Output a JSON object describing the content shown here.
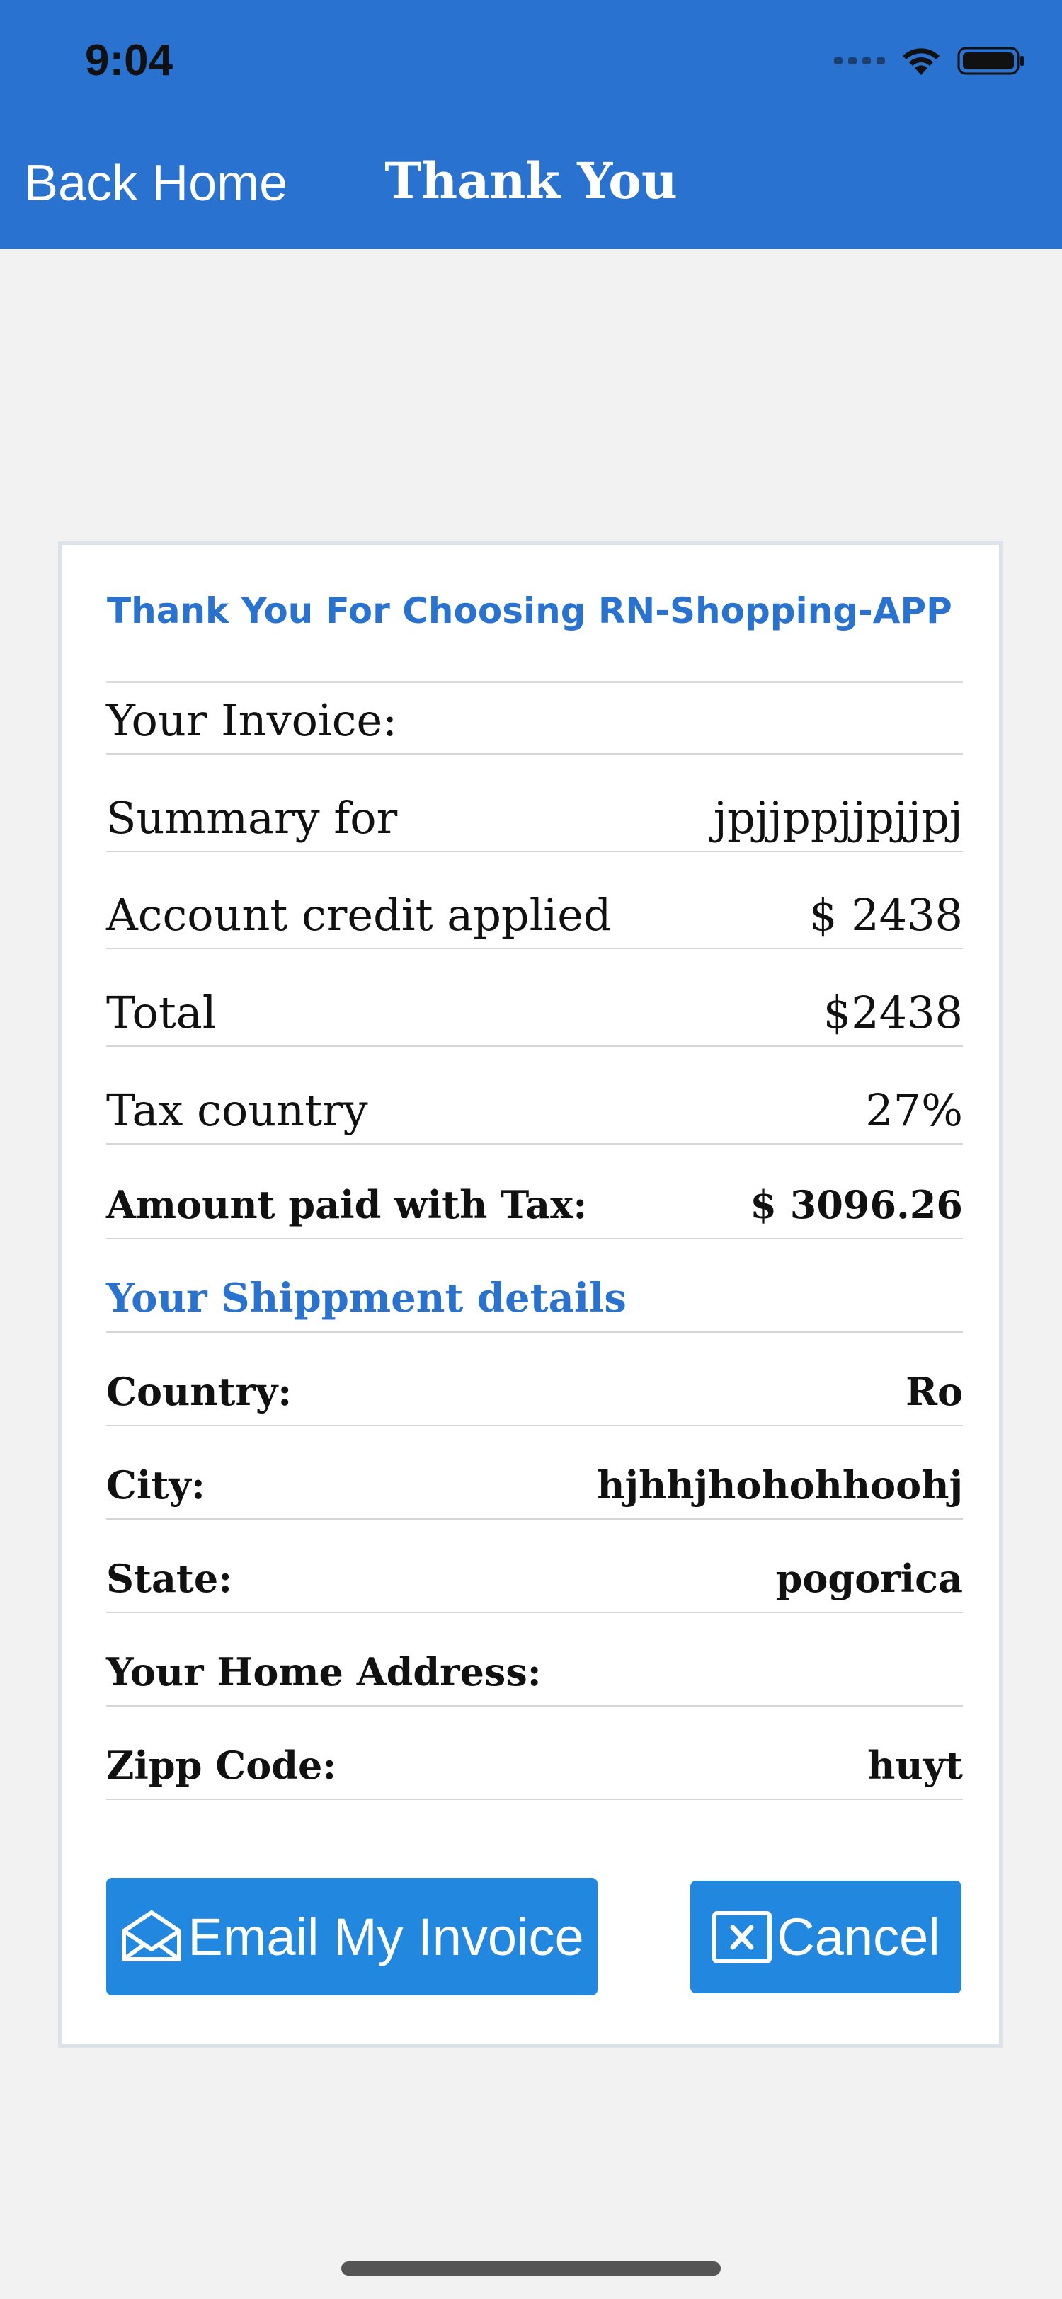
{
  "status_bar": {
    "time": "9:04"
  },
  "nav": {
    "back_label": "Back Home",
    "title": "Thank You"
  },
  "card": {
    "heading": "Thank You For Choosing RN-Shopping-APP",
    "rows": [
      {
        "label": "Your Invoice:",
        "value": ""
      },
      {
        "label": "Summary for",
        "value": "jpjjppjjpjjpj"
      },
      {
        "label": "Account credit applied",
        "value": "$ 2438"
      },
      {
        "label": "Total",
        "value": "$2438"
      },
      {
        "label": "Tax country",
        "value": "27%"
      },
      {
        "label": "Amount paid with Tax:",
        "value": "$ 3096.26"
      },
      {
        "label": "Your Shippment details",
        "value": ""
      },
      {
        "label": "Country:",
        "value": "Ro"
      },
      {
        "label": "City:",
        "value": "hjhhjhohohhoohj"
      },
      {
        "label": "State:",
        "value": "pogorica"
      },
      {
        "label": "Your Home Address:",
        "value": ""
      },
      {
        "label": "Zipp Code:",
        "value": "huyt"
      }
    ],
    "email_button": {
      "label": "Email My Invoice",
      "icon": "envelope-open-icon"
    },
    "cancel_button": {
      "label": "Cancel",
      "icon": "close-box-icon"
    }
  },
  "colors": {
    "header": "#2a72d0",
    "button": "#2287de",
    "accent": "#2a72d0",
    "background": "#f2f2f2"
  }
}
